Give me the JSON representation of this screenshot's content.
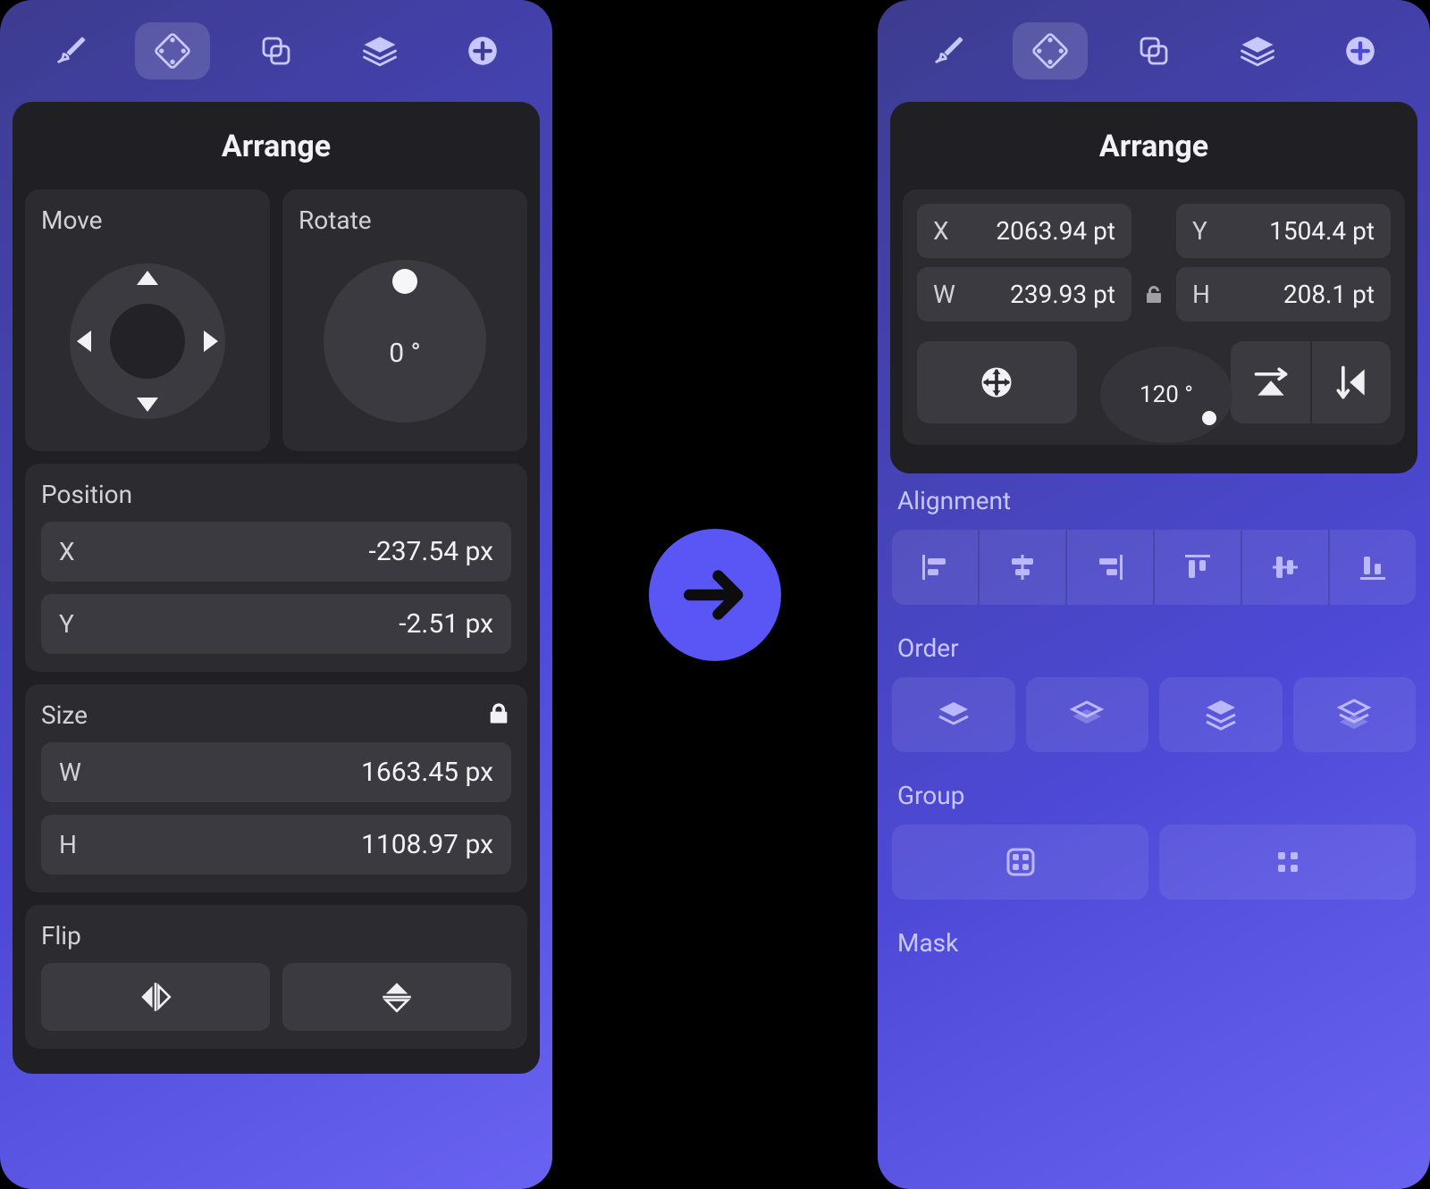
{
  "topbar_icons": [
    "brush",
    "arrange",
    "combine",
    "layers",
    "add"
  ],
  "left_panel": {
    "title": "Arrange",
    "move": {
      "label": "Move"
    },
    "rotate": {
      "label": "Rotate",
      "value": "0 °"
    },
    "position": {
      "label": "Position",
      "x_label": "X",
      "x_value": "-237.54 px",
      "y_label": "Y",
      "y_value": "-2.51 px"
    },
    "size": {
      "label": "Size",
      "locked": true,
      "w_label": "W",
      "w_value": "1663.45 px",
      "h_label": "H",
      "h_value": "1108.97 px"
    },
    "flip": {
      "label": "Flip"
    }
  },
  "right_panel": {
    "title": "Arrange",
    "coords": {
      "x_label": "X",
      "x_value": "2063.94 pt",
      "y_label": "Y",
      "y_value": "1504.4 pt",
      "w_label": "W",
      "w_value": "239.93 pt",
      "h_label": "H",
      "h_value": "208.1 pt",
      "locked": false
    },
    "rotate_value": "120 °",
    "alignment": {
      "label": "Alignment"
    },
    "order": {
      "label": "Order"
    },
    "group": {
      "label": "Group"
    },
    "mask": {
      "label": "Mask"
    }
  },
  "colors": {
    "accent": "#5a55f5",
    "panel_bg": "#202024",
    "section_bg": "#2c2c30",
    "field_bg": "#3a3a40"
  }
}
